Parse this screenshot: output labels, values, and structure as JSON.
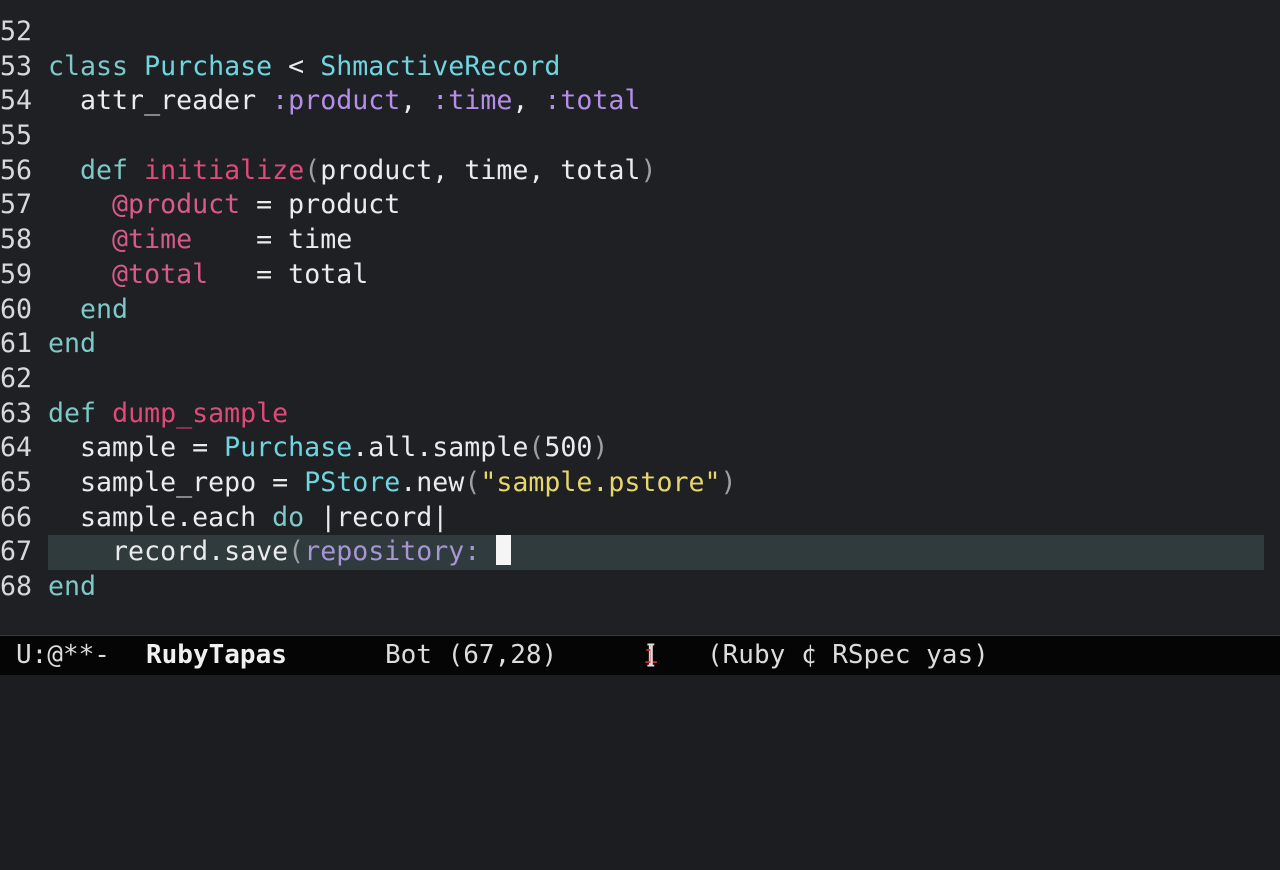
{
  "editor": {
    "lines": [
      {
        "num": "52",
        "parts": []
      },
      {
        "num": "53",
        "parts": [
          [
            "kw",
            "class"
          ],
          [
            "plain",
            " "
          ],
          [
            "const",
            "Purchase"
          ],
          [
            "plain",
            " < "
          ],
          [
            "const",
            "ShmactiveRecord"
          ]
        ]
      },
      {
        "num": "54",
        "parts": [
          [
            "plain",
            "  attr_reader "
          ],
          [
            "sym",
            ":product"
          ],
          [
            "plain",
            ", "
          ],
          [
            "sym",
            ":time"
          ],
          [
            "plain",
            ", "
          ],
          [
            "sym",
            ":total"
          ]
        ]
      },
      {
        "num": "55",
        "parts": []
      },
      {
        "num": "56",
        "parts": [
          [
            "plain",
            "  "
          ],
          [
            "kw",
            "def"
          ],
          [
            "plain",
            " "
          ],
          [
            "fn",
            "initialize"
          ],
          [
            "paren",
            "("
          ],
          [
            "plain",
            "product, time, total"
          ],
          [
            "paren",
            ")"
          ]
        ]
      },
      {
        "num": "57",
        "parts": [
          [
            "plain",
            "    "
          ],
          [
            "ivar",
            "@product"
          ],
          [
            "plain",
            " = product"
          ]
        ]
      },
      {
        "num": "58",
        "parts": [
          [
            "plain",
            "    "
          ],
          [
            "ivar",
            "@time"
          ],
          [
            "plain",
            "    = time"
          ]
        ]
      },
      {
        "num": "59",
        "parts": [
          [
            "plain",
            "    "
          ],
          [
            "ivar",
            "@total"
          ],
          [
            "plain",
            "   = total"
          ]
        ]
      },
      {
        "num": "60",
        "parts": [
          [
            "plain",
            "  "
          ],
          [
            "kw",
            "end"
          ]
        ]
      },
      {
        "num": "61",
        "parts": [
          [
            "kw",
            "end"
          ]
        ]
      },
      {
        "num": "62",
        "parts": []
      },
      {
        "num": "63",
        "parts": [
          [
            "kw",
            "def"
          ],
          [
            "plain",
            " "
          ],
          [
            "fn",
            "dump_sample"
          ]
        ]
      },
      {
        "num": "64",
        "parts": [
          [
            "plain",
            "  sample = "
          ],
          [
            "const",
            "Purchase"
          ],
          [
            "plain",
            ".all.sample"
          ],
          [
            "paren",
            "("
          ],
          [
            "plain",
            "500"
          ],
          [
            "paren",
            ")"
          ]
        ]
      },
      {
        "num": "65",
        "parts": [
          [
            "plain",
            "  sample_repo = "
          ],
          [
            "const",
            "PStore"
          ],
          [
            "plain",
            ".new"
          ],
          [
            "paren",
            "("
          ],
          [
            "str",
            "\"sample.pstore\""
          ],
          [
            "paren",
            ")"
          ]
        ]
      },
      {
        "num": "66",
        "parts": [
          [
            "plain",
            "  sample.each "
          ],
          [
            "kw",
            "do"
          ],
          [
            "plain",
            " |record|"
          ]
        ]
      },
      {
        "num": "67",
        "current": true,
        "parts": [
          [
            "plain",
            "    record.save"
          ],
          [
            "paren",
            "("
          ],
          [
            "kwarg",
            "repository:"
          ],
          [
            "plain",
            " "
          ]
        ]
      },
      {
        "num": "68",
        "parts": [
          [
            "kw",
            "end"
          ]
        ]
      }
    ]
  },
  "mode_line": {
    "state": "U:@**-",
    "buffer_name": "RubyTapas",
    "position": "Bot (67,28)",
    "evil_open": "[",
    "evil_state": "i",
    "evil_close": "]",
    "modes": "(Ruby ¢ RSpec yas)"
  },
  "colors": {
    "keyword": "#7ec8c8",
    "constant": "#6fd6e0",
    "function": "#e04a78",
    "symbol": "#b58ee8",
    "instance_var": "#d85a8a",
    "string": "#e7d66a",
    "current_line_bg": "#2f3b3c",
    "evil_indicator": "#e0252f"
  }
}
